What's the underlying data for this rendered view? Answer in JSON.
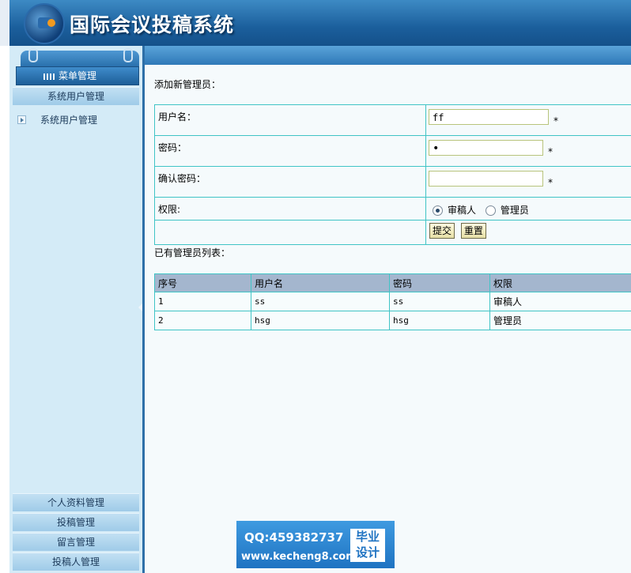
{
  "header": {
    "title": "国际会议投稿系统"
  },
  "sidebar": {
    "menu_button": "菜单管理",
    "section_top": "系统用户管理",
    "item": "系统用户管理",
    "bottom_sections": [
      "个人资料管理",
      "投稿管理",
      "留言管理",
      "投稿人管理"
    ]
  },
  "form": {
    "heading": "添加新管理员：",
    "username_label": "用户名：",
    "username_value": "ff",
    "password_label": "密码：",
    "password_value": "•",
    "confirm_label": "确认密码：",
    "confirm_value": "",
    "required_mark": "*",
    "role_label": "权限:",
    "role_options": [
      "审稿人",
      "管理员"
    ],
    "role_selected": "审稿人",
    "submit_label": "提交",
    "reset_label": "重置"
  },
  "list": {
    "heading": "已有管理员列表：",
    "columns": [
      "序号",
      "用户名",
      "密码",
      "权限"
    ],
    "rows": [
      [
        "1",
        "ss",
        "ss",
        "审稿人"
      ],
      [
        "2",
        "hsg",
        "hsg",
        "管理员"
      ]
    ]
  },
  "watermark": {
    "qq": "QQ:459382737",
    "url": "www.kecheng8.com",
    "badge_line1": "毕业",
    "badge_line2": "设计"
  }
}
